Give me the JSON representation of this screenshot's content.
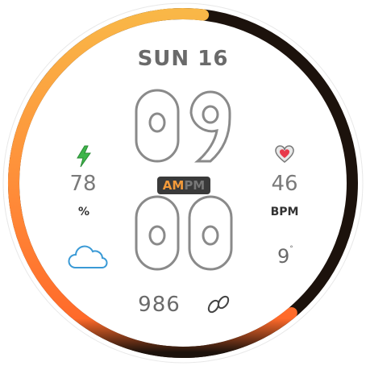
{
  "date": {
    "text": "SUN 16"
  },
  "time": {
    "hours": "09",
    "minutes": "00",
    "am": "AM",
    "pm": "PM",
    "active": "AM"
  },
  "battery": {
    "value": "78",
    "unit": "%",
    "icon": "lightning-bolt-icon"
  },
  "heart_rate": {
    "value": "46",
    "unit": "BPM",
    "icon": "heart-icon"
  },
  "weather": {
    "temp": "9",
    "unit": "°",
    "icon": "cloud-icon"
  },
  "steps": {
    "value": "986",
    "icon": "footsteps-icon"
  },
  "progress_ring": {
    "fraction": 0.63
  },
  "colors": {
    "ring_start": "#f7b140",
    "ring_end": "#ff7a30",
    "ring_track": "#1c120c",
    "accent": "#f39a3a",
    "bolt": "#3db54a",
    "heart": "#e8384a"
  }
}
